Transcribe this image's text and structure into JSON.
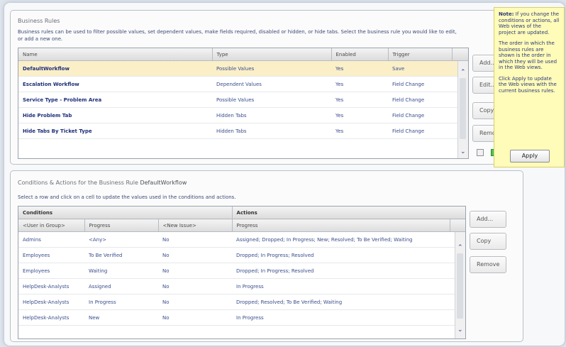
{
  "business_rules": {
    "title": "Business Rules",
    "description": "Business rules can be used to filter possible values, set dependent values, make fields required, disabled or hidden, or hide tabs. Select the business rule you would like to edit, or add a new one.",
    "columns": [
      "Name",
      "Type",
      "Enabled",
      "Trigger"
    ],
    "rows": [
      {
        "name": "DefaultWorkflow",
        "type": "Possible Values",
        "enabled": "Yes",
        "trigger": "Save",
        "selected": true
      },
      {
        "name": "Escalation Workflow",
        "type": "Dependent Values",
        "enabled": "Yes",
        "trigger": "Field Change"
      },
      {
        "name": "Service Type - Problem Area",
        "type": "Possible Values",
        "enabled": "Yes",
        "trigger": "Field Change"
      },
      {
        "name": "Hide Problem Tab",
        "type": "Hidden Tabs",
        "enabled": "Yes",
        "trigger": "Field Change"
      },
      {
        "name": "Hide Tabs By Ticket Type",
        "type": "Hidden Tabs",
        "enabled": "Yes",
        "trigger": "Field Change"
      }
    ],
    "buttons": {
      "add": "Add...",
      "edit": "Edit...",
      "copy": "Copy...",
      "remove": "Remove"
    }
  },
  "note": {
    "p1_bold": "Note:",
    "p1": " If you change the conditions or actions, all Web views of the project are updated.",
    "p2": "The order in which the business rules are shown is the order in which they will be used in the Web views.",
    "p3": "Click Apply to update the Web views with the current business rules.",
    "apply": "Apply"
  },
  "conditions_actions": {
    "title_prefix": "Conditions & Actions for the Business Rule ",
    "title_rule": "DefaultWorkflow",
    "description": "Select a row and click on a cell to update the values used in the conditions and actions.",
    "group_headers": {
      "conditions": "Conditions",
      "actions": "Actions"
    },
    "columns": [
      "<User in Group>",
      "Progress",
      "<New Issue>",
      "Progress"
    ],
    "rows": [
      {
        "group": "Admins",
        "progress": "<Any>",
        "new_issue": "No",
        "actions": "Assigned; Dropped; In Progress; New; Resolved; To Be Verified; Waiting"
      },
      {
        "group": "Employees",
        "progress": "To Be Verified",
        "new_issue": "No",
        "actions": "Dropped; In Progress; Resolved"
      },
      {
        "group": "Employees",
        "progress": "Waiting",
        "new_issue": "No",
        "actions": "Dropped; In Progress; Resolved"
      },
      {
        "group": "HelpDesk-Analysts",
        "progress": "Assigned",
        "new_issue": "No",
        "actions": "In Progress"
      },
      {
        "group": "HelpDesk-Analysts",
        "progress": "In Progress",
        "new_issue": "No",
        "actions": "Dropped; Resolved; To Be Verified; Waiting"
      },
      {
        "group": "HelpDesk-Analysts",
        "progress": "New",
        "new_issue": "No",
        "actions": "In Progress"
      }
    ],
    "buttons": {
      "add": "Add...",
      "copy": "Copy",
      "remove": "Remove"
    }
  },
  "colors": {
    "selected_row": "#fbefc8",
    "note_bg": "#fffbb8",
    "link_text": "#1e2f7a"
  }
}
